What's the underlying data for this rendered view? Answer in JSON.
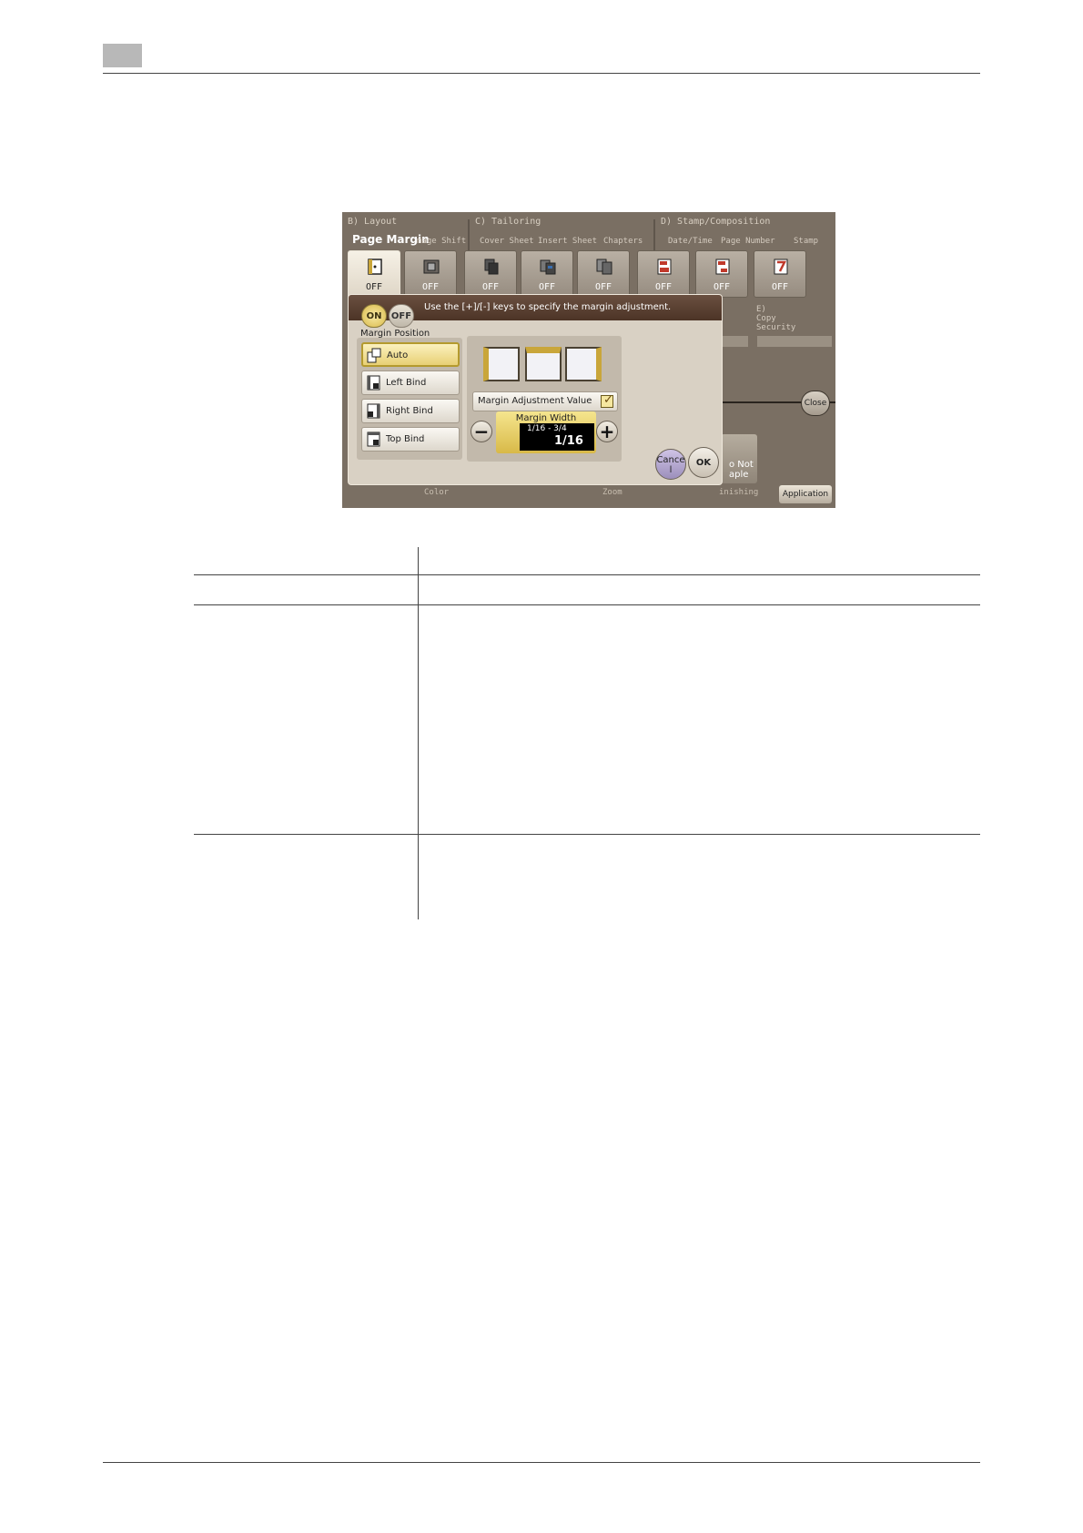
{
  "screen": {
    "sections": {
      "layout": "B)  Layout",
      "tailoring": "C)  Tailoring",
      "stamp": "D)  Stamp/Composition",
      "copy_security": "E)\nCopy\nSecurity"
    },
    "page_margin_title": "Page Margin",
    "function_labels": [
      "mage Shift",
      "Cover Sheet",
      "Insert Sheet",
      "Chapters",
      "Date/Time",
      "Page Number",
      "Stamp"
    ],
    "function_buttons": [
      {
        "state": "OFF",
        "icon": "page-margin-icon"
      },
      {
        "state": "OFF",
        "icon": "image-shift-icon"
      },
      {
        "state": "OFF",
        "icon": "cover-sheet-icon"
      },
      {
        "state": "OFF",
        "icon": "insert-sheet-icon"
      },
      {
        "state": "OFF",
        "icon": "chapters-icon"
      },
      {
        "state": "OFF",
        "icon": "date-time-icon"
      },
      {
        "state": "OFF",
        "icon": "page-number-icon"
      },
      {
        "state": "OFF",
        "icon": "stamp-icon"
      }
    ],
    "close_label": "Close",
    "not_staple_label": "o Not\naple",
    "bottom_labels": {
      "color": "Color",
      "zoom": "Zoom",
      "finishing": "inishing"
    },
    "application_label": "Application",
    "dialog": {
      "on_label": "ON",
      "off_label": "OFF",
      "message": "Use the [+]/[-] keys to specify the margin adjustment.",
      "margin_position_label": "Margin Position",
      "positions": [
        {
          "label": "Auto",
          "selected": true
        },
        {
          "label": "Left Bind",
          "selected": false
        },
        {
          "label": "Right Bind",
          "selected": false
        },
        {
          "label": "Top Bind",
          "selected": false
        }
      ],
      "adjustment_value_label": "Margin Adjustment Value",
      "adjustment_checked": true,
      "minus_label": "−",
      "plus_label": "+",
      "margin_width_title": "Margin Width",
      "margin_width_range": "1/16 - 3/4",
      "margin_width_value": "1/16",
      "cancel_label": "Cance\nl",
      "ok_label": "OK"
    },
    "colors": {
      "accent_gold": "#d9b94a",
      "background": "#7a6f63",
      "dialog_header": "#5a4030"
    }
  }
}
